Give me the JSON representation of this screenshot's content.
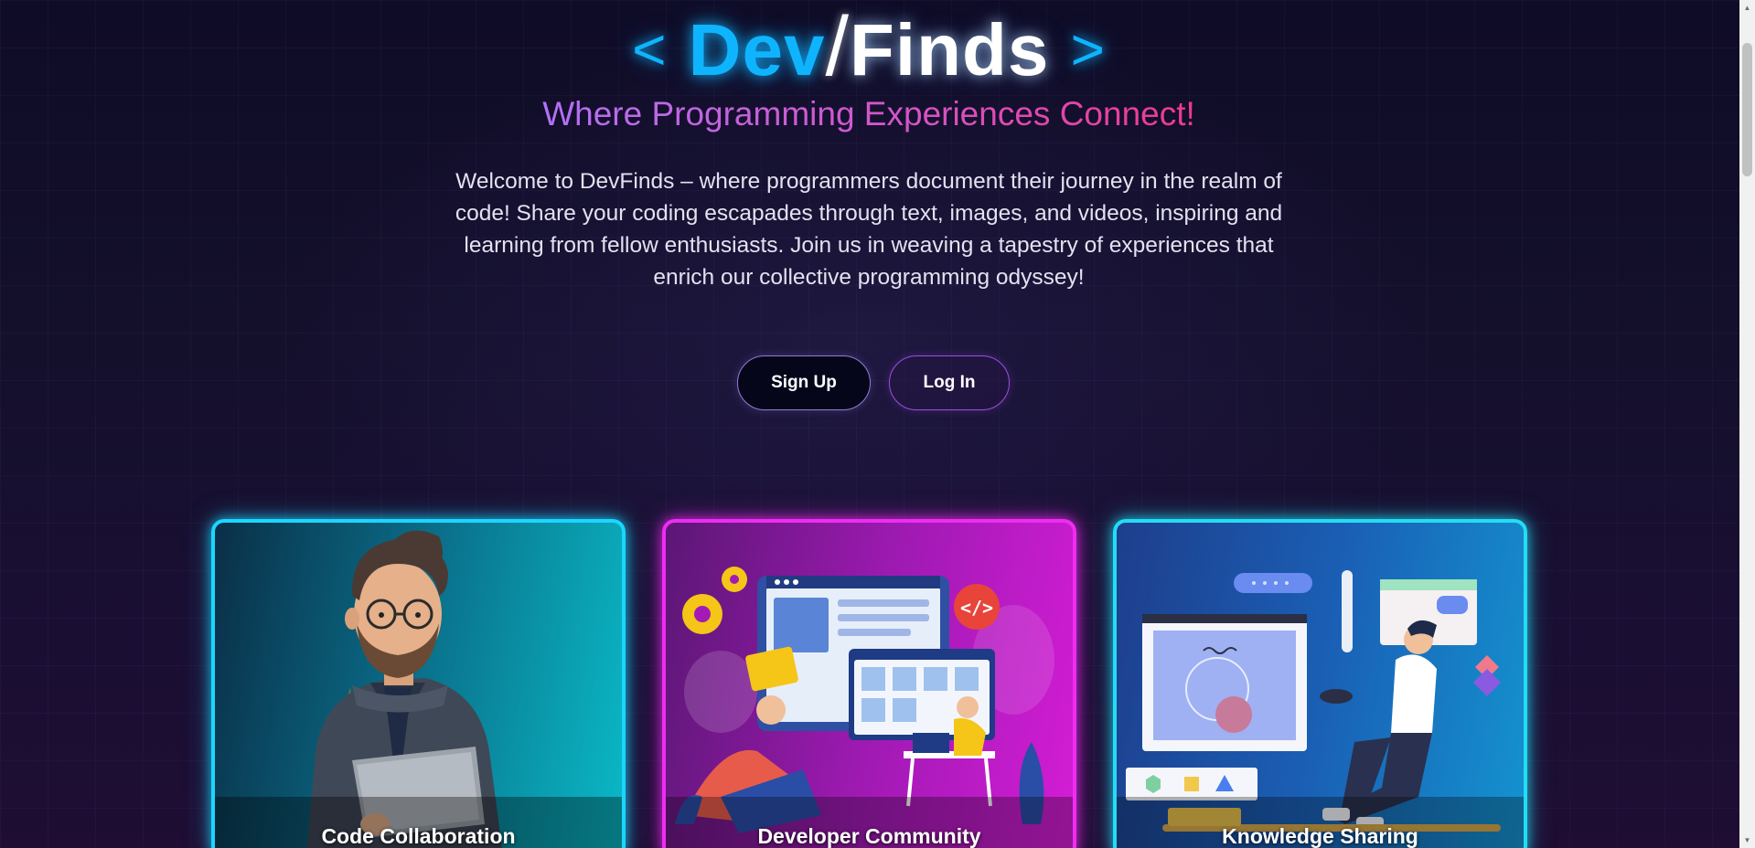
{
  "logo": {
    "open_bracket": "<",
    "dev": "Dev",
    "slash": "/",
    "finds": "Finds",
    "close_bracket": ">"
  },
  "tagline": "Where Programming Experiences Connect!",
  "intro": "Welcome to DevFinds – where programmers document their journey in the realm of code! Share your coding escapades through text, images, and videos, inspiring and learning from fellow enthusiasts. Join us in weaving a tapestry of experiences that enrich our collective programming odyssey!",
  "buttons": {
    "signup": "Sign Up",
    "login": "Log In"
  },
  "cards": [
    {
      "title": "Code Collaboration",
      "accent": "#1bd6ff",
      "illustration": "developer-with-laptop-illustration"
    },
    {
      "title": "Developer Community",
      "accent": "#ef2cf2",
      "illustration": "community-dashboard-illustration"
    },
    {
      "title": "Knowledge Sharing",
      "accent": "#23dcf5",
      "illustration": "learning-with-tablet-illustration"
    }
  ],
  "code_badge": "</>",
  "colors": {
    "background": "#100c26",
    "logo_blue": "#0fb4ff",
    "tagline_start": "#b271f5",
    "tagline_end": "#ec3a8e"
  }
}
